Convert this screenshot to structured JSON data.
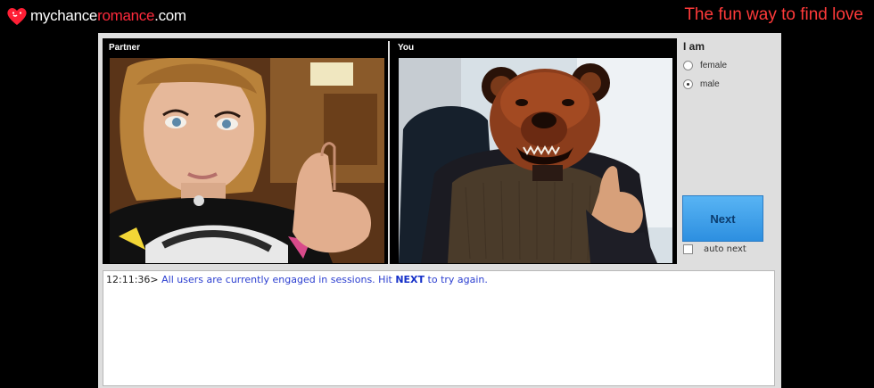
{
  "site": {
    "logo_parts": [
      "my",
      "chance",
      "romance",
      ".com"
    ],
    "tagline": "The fun way to find love"
  },
  "video": {
    "partner_label": "Partner",
    "you_label": "You"
  },
  "controls": {
    "iam_label": "I am",
    "gender_options": [
      {
        "label": "female",
        "selected": false
      },
      {
        "label": "male",
        "selected": true
      }
    ],
    "next_label": "Next",
    "auto_next_label": "auto next",
    "auto_next_checked": false
  },
  "chat": {
    "messages": [
      {
        "timestamp": "12:11:36>",
        "text_before": "All users are currently engaged in sessions. Hit",
        "keyword": "NEXT",
        "text_after": "to try again."
      }
    ]
  },
  "colors": {
    "brand_red": "#ff2a3c",
    "button_blue": "#3a9ee8",
    "chat_text": "#2b3ed0"
  },
  "icons": [
    "heart-icon",
    "radio-icon",
    "checkbox-icon"
  ]
}
